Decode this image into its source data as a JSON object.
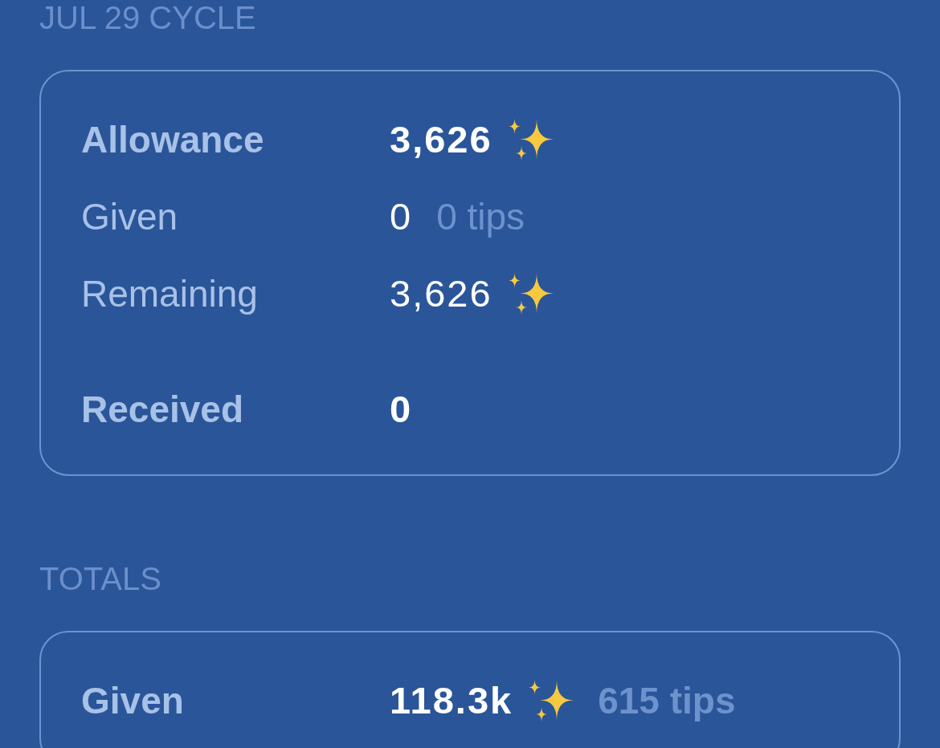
{
  "sections": [
    {
      "title": "JUL 29 CYCLE",
      "groups": [
        {
          "rows": [
            {
              "kind": "headline",
              "label": "Allowance",
              "value": "3,626",
              "sparkle": true
            },
            {
              "kind": "detail",
              "label": "Given",
              "value": "0",
              "sparkle": false,
              "tips": "0 tips"
            },
            {
              "kind": "detail",
              "label": "Remaining",
              "value": "3,626",
              "sparkle": true
            }
          ]
        },
        {
          "rows": [
            {
              "kind": "headline",
              "label": "Received",
              "value": "0",
              "sparkle": false
            }
          ]
        }
      ]
    },
    {
      "title": "TOTALS",
      "groups": [
        {
          "rows": [
            {
              "kind": "headline",
              "label": "Given",
              "value": "118.3k",
              "sparkle": true,
              "tips": "615 tips"
            }
          ]
        }
      ]
    }
  ]
}
